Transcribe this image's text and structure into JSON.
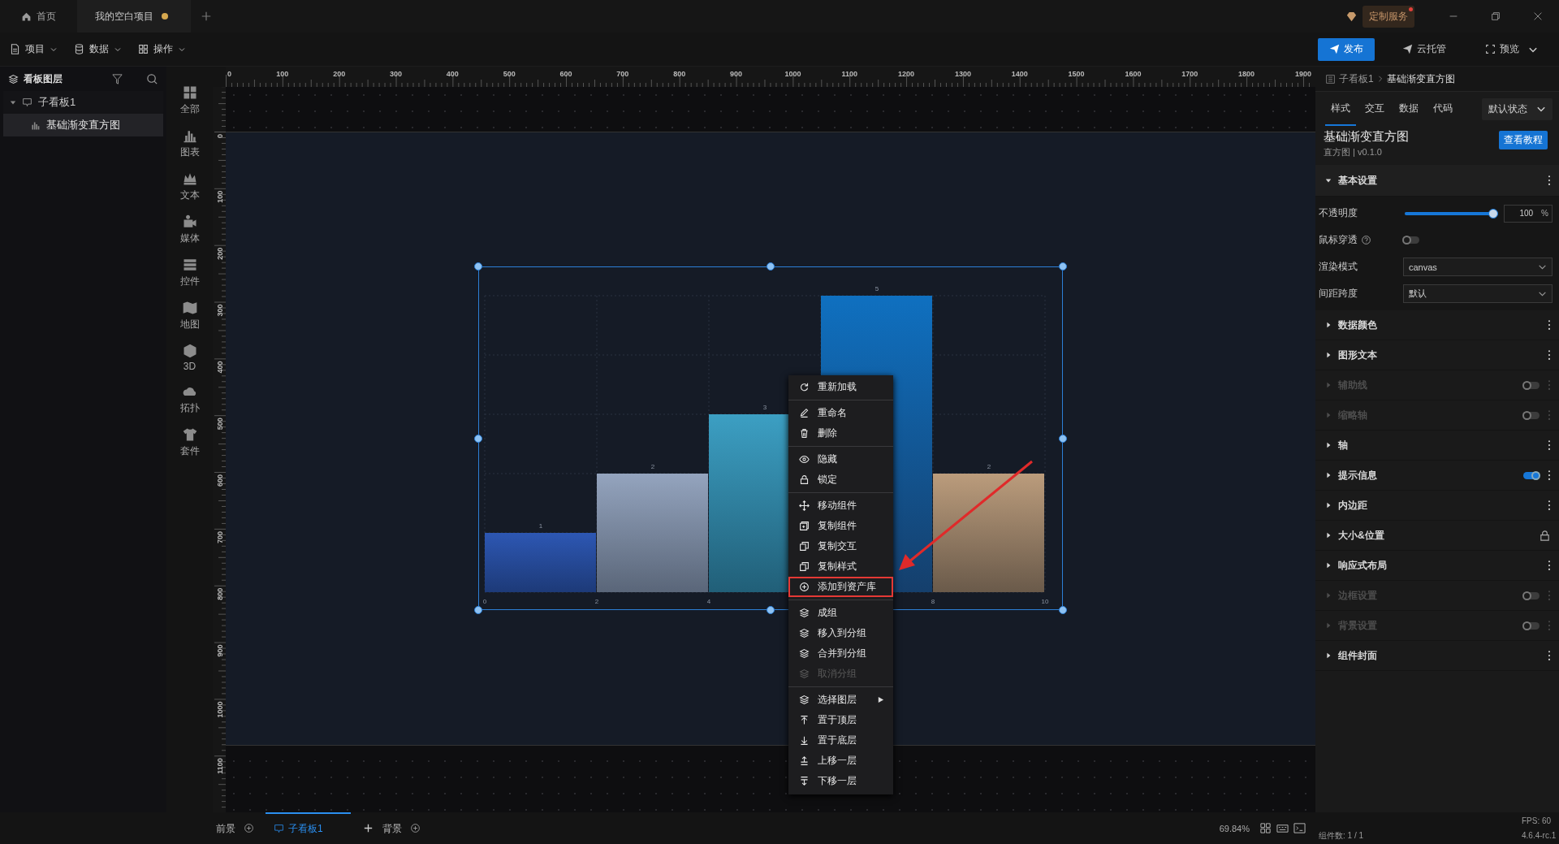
{
  "title_bar": {
    "tabs": [
      {
        "label": "首页",
        "selected": false,
        "modified": false
      },
      {
        "label": "我的空白项目",
        "selected": true,
        "modified": true
      }
    ],
    "service_button": "定制服务"
  },
  "menu_bar": {
    "menus": [
      "项目",
      "数据",
      "操作"
    ],
    "actions": [
      {
        "label": "发布",
        "primary": true,
        "dropdown": false
      },
      {
        "label": "云托管",
        "primary": false,
        "dropdown": false
      },
      {
        "label": "预览",
        "primary": false,
        "dropdown": true
      }
    ]
  },
  "layers_panel": {
    "title": "看板图层",
    "tree": [
      {
        "label": "子看板1",
        "expanded": true,
        "selected": false,
        "children": [
          {
            "label": "基础渐变直方图",
            "selected": true
          }
        ]
      }
    ]
  },
  "component_categories": [
    "全部",
    "图表",
    "文本",
    "媒体",
    "控件",
    "地图",
    "3D",
    "拓扑",
    "套件"
  ],
  "rulers": {
    "horizontal": [
      "0",
      "100",
      "200",
      "300",
      "400",
      "500",
      "600",
      "700",
      "800",
      "900",
      "1000",
      "1100",
      "1200",
      "1300",
      "1400",
      "1500",
      "1600",
      "1700",
      "1800",
      "1900"
    ],
    "vertical": [
      "0",
      "100",
      "200",
      "300",
      "400",
      "500",
      "600",
      "700",
      "800",
      "900",
      "1000",
      "1100"
    ]
  },
  "canvas": {
    "component": {
      "selected": true,
      "chart_data": {
        "type": "bar",
        "x": [
          1,
          3,
          5,
          7,
          9
        ],
        "values": [
          1,
          2,
          3,
          5,
          2
        ],
        "xlim": [
          0,
          10
        ],
        "xticks": [
          0,
          2,
          4,
          8,
          10
        ],
        "data_labels": true,
        "grid": true
      }
    },
    "context_menu": {
      "groups": [
        [
          {
            "label": "重新加载",
            "disabled": false,
            "outlined": false
          }
        ],
        [
          {
            "label": "重命名",
            "disabled": false,
            "outlined": false
          },
          {
            "label": "删除",
            "disabled": false,
            "outlined": false
          }
        ],
        [
          {
            "label": "隐藏",
            "disabled": false,
            "outlined": false
          },
          {
            "label": "锁定",
            "disabled": false,
            "outlined": false
          }
        ],
        [
          {
            "label": "移动组件",
            "disabled": false,
            "outlined": false
          },
          {
            "label": "复制组件",
            "disabled": false,
            "outlined": false
          },
          {
            "label": "复制交互",
            "disabled": false,
            "outlined": false
          },
          {
            "label": "复制样式",
            "disabled": false,
            "outlined": false
          },
          {
            "label": "添加到资产库",
            "disabled": false,
            "outlined": true
          }
        ],
        [
          {
            "label": "成组",
            "disabled": false,
            "outlined": false
          },
          {
            "label": "移入到分组",
            "disabled": false,
            "outlined": false
          },
          {
            "label": "合并到分组",
            "disabled": false,
            "outlined": false
          },
          {
            "label": "取消分组",
            "disabled": true,
            "outlined": false
          }
        ],
        [
          {
            "label": "选择图层",
            "disabled": false,
            "outlined": false,
            "submenu": true
          },
          {
            "label": "置于顶层",
            "disabled": false,
            "outlined": false
          },
          {
            "label": "置于底层",
            "disabled": false,
            "outlined": false
          },
          {
            "label": "上移一层",
            "disabled": false,
            "outlined": false
          },
          {
            "label": "下移一层",
            "disabled": false,
            "outlined": false
          }
        ]
      ]
    },
    "callout": {
      "kind": "arrow"
    }
  },
  "inspector": {
    "breadcrumb": [
      "子看板1",
      "基础渐变直方图"
    ],
    "tabs": [
      {
        "label": "样式",
        "selected": true
      },
      {
        "label": "交互",
        "selected": false
      },
      {
        "label": "数据",
        "selected": false
      },
      {
        "label": "代码",
        "selected": false
      }
    ],
    "state_select": "默认状态",
    "component_name": "基础渐变直方图",
    "component_type": "直方图 | v0.1.0",
    "tutorial_button": "查看教程",
    "sections": [
      {
        "label": "基本设置",
        "expanded": true,
        "disabled": false,
        "kind": "more",
        "fields": [
          {
            "kind": "slider",
            "label": "不透明度",
            "level": 1,
            "value": "100",
            "unit": "%"
          },
          {
            "kind": "toggle",
            "label": "鼠标穿透",
            "help": true,
            "on": false
          },
          {
            "kind": "select",
            "label": "渲染模式",
            "value": "canvas"
          },
          {
            "kind": "select",
            "label": "间距跨度",
            "value": "默认"
          }
        ]
      },
      {
        "label": "数据颜色",
        "expanded": false,
        "disabled": false,
        "kind": "more"
      },
      {
        "label": "图形文本",
        "expanded": false,
        "disabled": false,
        "kind": "more"
      },
      {
        "label": "辅助线",
        "expanded": false,
        "disabled": true,
        "kind": "toggle",
        "on": false
      },
      {
        "label": "缩略轴",
        "expanded": false,
        "disabled": true,
        "kind": "toggle",
        "on": false
      },
      {
        "label": "轴",
        "expanded": false,
        "disabled": false,
        "kind": "more"
      },
      {
        "label": "提示信息",
        "expanded": false,
        "disabled": false,
        "kind": "toggle",
        "on": true
      },
      {
        "label": "内边距",
        "expanded": false,
        "disabled": false,
        "kind": "more"
      },
      {
        "label": "大小&位置",
        "expanded": false,
        "disabled": false,
        "kind": "lock"
      },
      {
        "label": "响应式布局",
        "expanded": false,
        "disabled": false,
        "kind": "more"
      },
      {
        "label": "边框设置",
        "expanded": false,
        "disabled": true,
        "kind": "toggle",
        "on": false
      },
      {
        "label": "背景设置",
        "expanded": false,
        "disabled": true,
        "kind": "toggle",
        "on": false
      },
      {
        "label": "组件封面",
        "expanded": false,
        "disabled": false,
        "kind": "more"
      }
    ]
  },
  "bottom_bar": {
    "layers": [
      {
        "label": "前景",
        "selected": false
      },
      {
        "label": "子看板1",
        "selected": true
      },
      {
        "label": "背景",
        "selected": false
      }
    ],
    "zoom": "69.84%",
    "fps": "FPS: 60",
    "component_count": "组件数: 1 / 1",
    "version": "4.6.4-rc.1"
  }
}
